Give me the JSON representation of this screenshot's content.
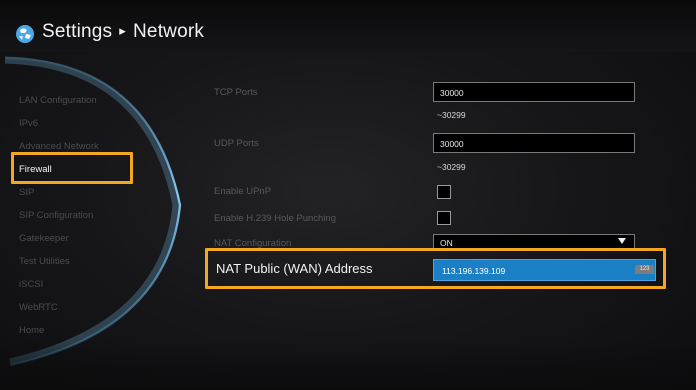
{
  "header": {
    "title": "Settings",
    "separator": "▸",
    "subtitle": "Network",
    "logo_icon": "globe-icon"
  },
  "sidebar": {
    "items": [
      {
        "label": "LAN Configuration"
      },
      {
        "label": "IPv6"
      },
      {
        "label": "Advanced Network"
      },
      {
        "label": "Firewall",
        "active": true
      },
      {
        "label": "SIP"
      },
      {
        "label": "SIP Configuration"
      },
      {
        "label": "Gatekeeper"
      },
      {
        "label": "Test Utilities"
      },
      {
        "label": "iSCSI"
      },
      {
        "label": "WebRTC"
      },
      {
        "label": "Home"
      }
    ]
  },
  "settings": {
    "tcp_ports": {
      "label": "TCP Ports",
      "value": "30000",
      "range": "~30299"
    },
    "udp_ports": {
      "label": "UDP Ports",
      "value": "30000",
      "range": "~30299"
    },
    "enable_upnp": {
      "label": "Enable UPnP",
      "checked": false
    },
    "enable_h239": {
      "label": "Enable H.239 Hole Punching",
      "checked": false
    },
    "nat_configuration": {
      "label": "NAT Configuration",
      "value": "ON"
    },
    "nat_public_wan": {
      "label": "NAT Public (WAN) Address",
      "value": "113.196.139.109",
      "input_mode_badge": "123"
    }
  },
  "colors": {
    "highlight_box": "#f5a623",
    "selected_field": "#1a7fc5",
    "background": "#0c0c0d"
  }
}
